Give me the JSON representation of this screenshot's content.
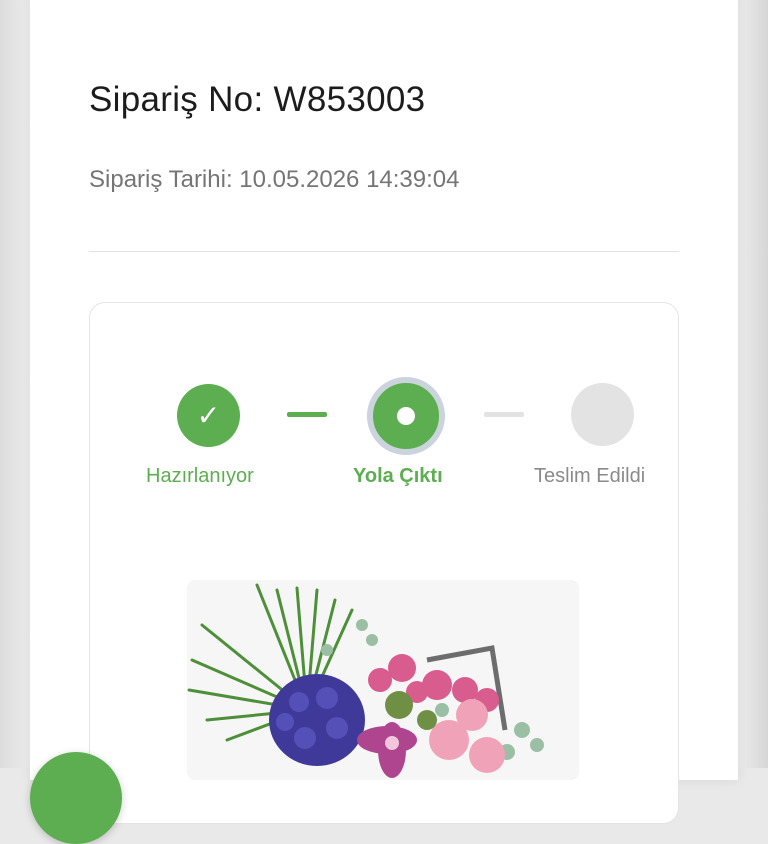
{
  "order": {
    "number_text": "Sipariş No: W853003",
    "date_text": "Sipariş Tarihi: 10.05.2026 14:39:04"
  },
  "tracking": {
    "steps": [
      {
        "label": "Hazırlanıyor",
        "status": "completed",
        "icon": "check-icon"
      },
      {
        "label": "Yola Çıktı",
        "status": "current",
        "icon": "dot-icon"
      },
      {
        "label": "Teslim Edildi",
        "status": "pending",
        "icon": "none"
      }
    ],
    "check_glyph": "✓"
  },
  "product": {
    "image": "flower-arrangement-image"
  },
  "colors": {
    "accent": "#5cae50",
    "inactive": "#e3e3e3",
    "ring": "#cbd3dc",
    "text": "#1c1c1c",
    "muted": "#757575"
  }
}
